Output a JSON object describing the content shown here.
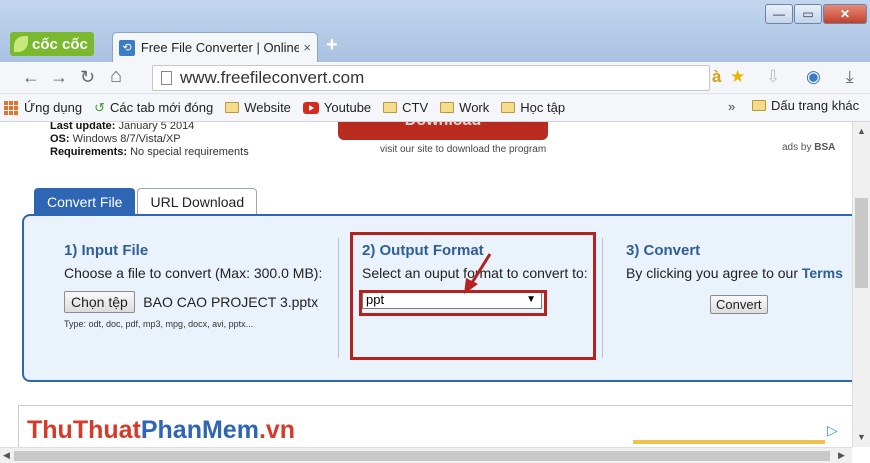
{
  "browser": {
    "brand": "cốc cốc",
    "tab_title": "Free File Converter | Online",
    "tab_close": "×",
    "new_tab": "+",
    "window_controls": {
      "minimize": "—",
      "maximize": "▭",
      "close": "✕"
    },
    "nav": {
      "back": "←",
      "forward": "→",
      "reload": "↻",
      "home": "⌂"
    },
    "url": "www.freefileconvert.com",
    "toolbar_icons": [
      "translate-icon",
      "star-icon",
      "download-icon",
      "extension-icon",
      "save-icon"
    ]
  },
  "bookmarks": {
    "items": [
      {
        "label": "Ứng dụng",
        "icon": "apps-icon"
      },
      {
        "label": "Các tab mới đóng",
        "icon": "history-icon"
      },
      {
        "label": "Website",
        "icon": "folder-icon"
      },
      {
        "label": "Youtube",
        "icon": "youtube-icon"
      },
      {
        "label": "CTV",
        "icon": "folder-icon"
      },
      {
        "label": "Work",
        "icon": "folder-icon"
      },
      {
        "label": "Học tập",
        "icon": "folder-icon"
      }
    ],
    "more": "»",
    "other": "Dấu trang khác"
  },
  "page": {
    "specs": {
      "last_update_label": "Last update:",
      "last_update_value": "January 5 2014",
      "os_label": "OS:",
      "os_value": "Windows 8/7/Vista/XP",
      "req_label": "Requirements:",
      "req_value": "No special requirements"
    },
    "download_button": "Download",
    "download_caption": "visit our site to download the program",
    "ads_prefix": "ads by",
    "ads_brand": "BSA",
    "tabs": [
      "Convert File",
      "URL Download"
    ],
    "step1": {
      "title": "1) Input File",
      "desc": "Choose a file to convert (Max: 300.0 MB):",
      "choose_button": "Chọn tệp",
      "filename": "BAO CAO PROJECT 3.pptx",
      "types": "Type: odt, doc, pdf, mp3, mpg, docx, avi, pptx..."
    },
    "step2": {
      "title": "2) Output Format",
      "desc": "Select an ouput format to convert to:",
      "selected": "ppt",
      "arrow": "▼"
    },
    "step3": {
      "title": "3) Convert",
      "desc_prefix": "By clicking you agree to our",
      "terms": "Terms",
      "convert_button": "Convert"
    },
    "watermark": {
      "part1": "ThuThuat",
      "part2": "PhanMem",
      "part3": ".vn"
    },
    "ad_icon": "▷"
  },
  "scrollbars": {
    "up": "▲",
    "down": "▼",
    "left": "◀",
    "right": "▶"
  },
  "colors": {
    "accent": "#2f66b3",
    "highlight": "#b3221e",
    "panel_bg": "#eaf2fb"
  }
}
